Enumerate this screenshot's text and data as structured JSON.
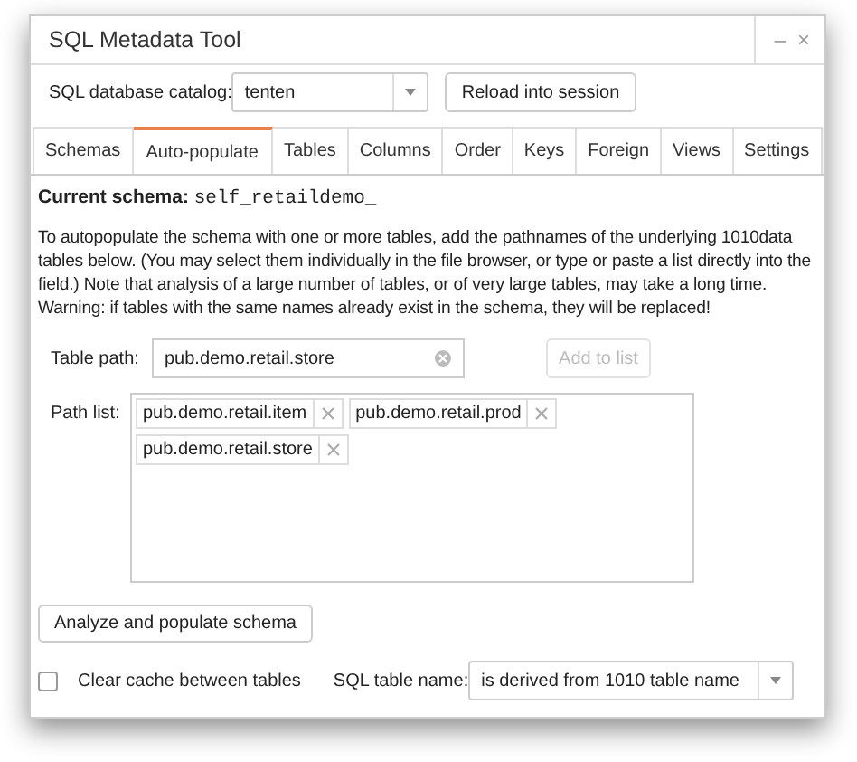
{
  "window": {
    "title": "SQL Metadata Tool",
    "controls": [
      "–",
      "×"
    ]
  },
  "catalog": {
    "label": "SQL database catalog:",
    "value": "tenten"
  },
  "reload_button": {
    "label": "Reload into session"
  },
  "tabs": [
    {
      "label": "Schemas",
      "selected": false
    },
    {
      "label": "Auto-populate",
      "selected": true
    },
    {
      "label": "Tables",
      "selected": false
    },
    {
      "label": "Columns",
      "selected": false
    },
    {
      "label": "Order",
      "selected": false
    },
    {
      "label": "Keys",
      "selected": false
    },
    {
      "label": "Foreign",
      "selected": false
    },
    {
      "label": "Views",
      "selected": false
    },
    {
      "label": "Settings",
      "selected": false
    }
  ],
  "current_schema": {
    "label": "Current schema:",
    "value": "self_retaildemo_"
  },
  "description": "To autopopulate the schema with one or more tables, add the pathnames of the underlying 1010data tables below. (You may select them individually in the file browser, or type or paste a list directly into the field.) Note that analysis of a large number of tables, or of very large tables, may take a long time. Warning: if tables with the same names already exist in the schema, they will be replaced!",
  "table_path": {
    "label": "Table path:",
    "value": "pub.demo.retail.store"
  },
  "add_button": {
    "label": "Add to list",
    "disabled": true
  },
  "path_list": {
    "label": "Path list:",
    "items": [
      "pub.demo.retail.item",
      "pub.demo.retail.prod",
      "pub.demo.retail.store"
    ]
  },
  "analyze_button": {
    "label": "Analyze and populate schema"
  },
  "clear_cache": {
    "label": "Clear cache between tables",
    "checked": false
  },
  "sql_table_name": {
    "label": "SQL table name:",
    "value": "is derived from 1010 table name"
  }
}
